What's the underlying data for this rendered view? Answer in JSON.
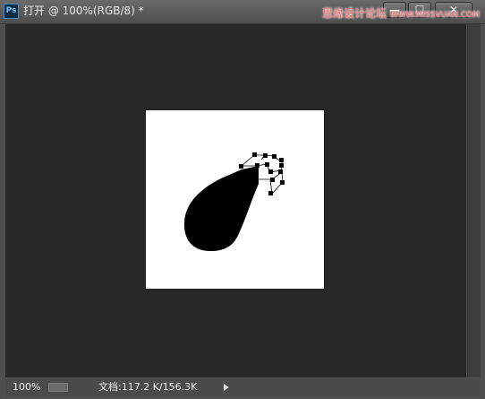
{
  "app": {
    "icon_label": "Ps",
    "title": "打开 @ 100%(RGB/8) *"
  },
  "window_controls": {
    "minimize": "—",
    "maximize": "☐",
    "close": "✕"
  },
  "watermark": {
    "forum": "思缘设计论坛",
    "site": "WWW.MISSVUAN.COM"
  },
  "status": {
    "zoom": "100%",
    "doc_info": "文档:117.2 K/156.3K"
  },
  "colors": {
    "workspace": "#282828",
    "canvas": "#ffffff",
    "shape": "#000000"
  }
}
